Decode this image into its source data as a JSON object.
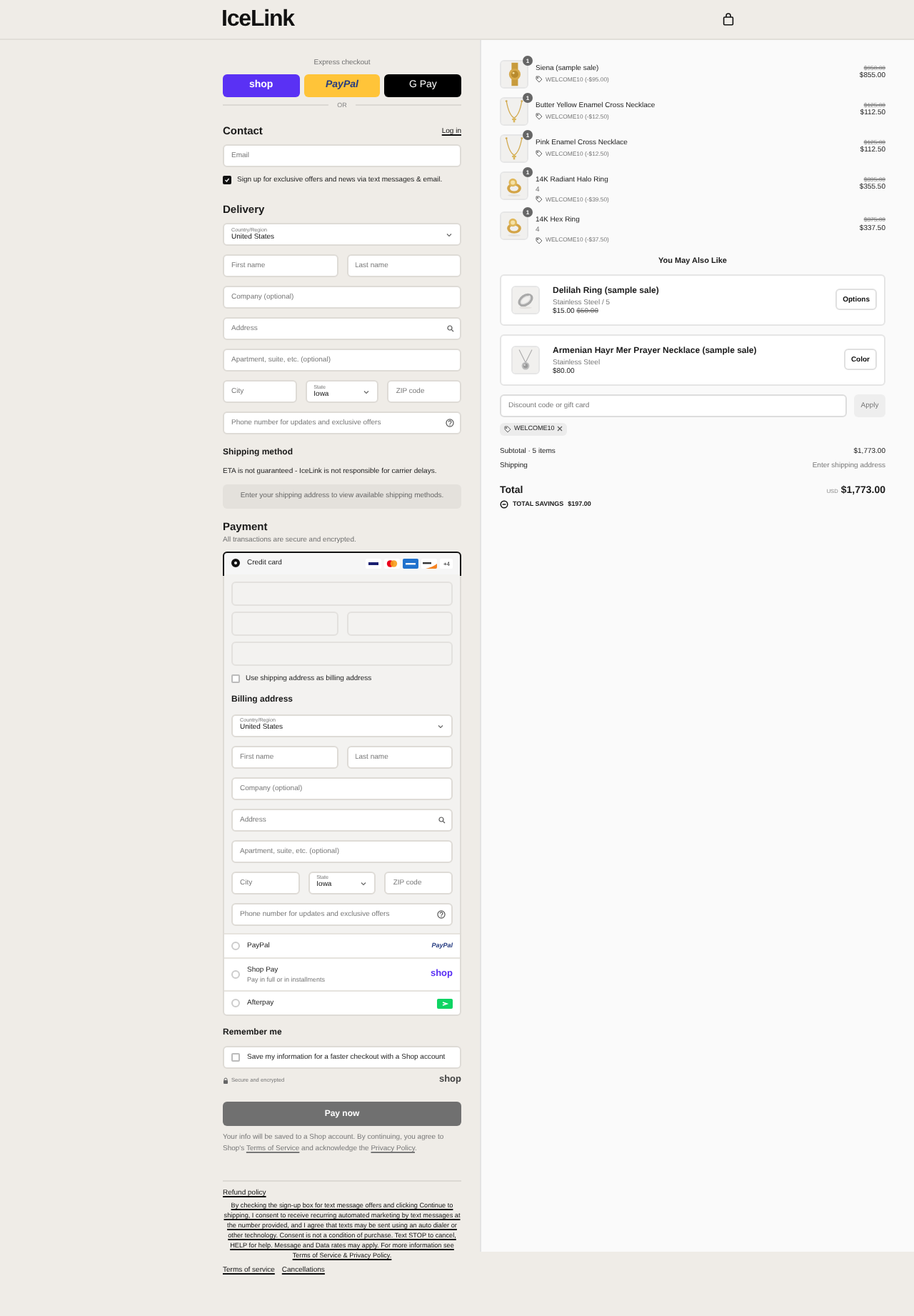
{
  "header": {
    "logo": "IceLink"
  },
  "express_checkout": {
    "title": "Express checkout",
    "buttons": [
      {
        "kind": "shop",
        "label": "shop"
      },
      {
        "kind": "paypal",
        "label": "PayPal"
      },
      {
        "kind": "gpay",
        "label": "G Pay"
      }
    ],
    "divider": "OR"
  },
  "contact": {
    "title": "Contact",
    "login_link": "Log in",
    "email": {
      "placeholder": "Email"
    },
    "marketing_opt_in": {
      "label": "Sign up for exclusive offers and news via text messages & email.",
      "checked": true
    }
  },
  "delivery": {
    "title": "Delivery",
    "country": {
      "label": "Country/Region",
      "value": "United States"
    },
    "first_name": {
      "placeholder": "First name"
    },
    "last_name": {
      "placeholder": "Last name"
    },
    "company": {
      "placeholder": "Company (optional)"
    },
    "address": {
      "placeholder": "Address"
    },
    "apartment": {
      "placeholder": "Apartment, suite, etc. (optional)"
    },
    "city": {
      "placeholder": "City"
    },
    "state": {
      "label": "State",
      "value": "Iowa"
    },
    "zip": {
      "placeholder": "ZIP code"
    },
    "phone": {
      "placeholder": "Phone number for updates and exclusive offers"
    }
  },
  "shipping_method": {
    "title": "Shipping method",
    "note": "ETA is not guaranteed - IceLink is not responsible for carrier delays.",
    "notice": "Enter your shipping address to view available shipping methods."
  },
  "payment": {
    "title": "Payment",
    "subtitle": "All transactions are secure and encrypted.",
    "methods": [
      {
        "kind": "card",
        "label": "Credit card",
        "more_brands": "+4",
        "selected": true
      },
      {
        "kind": "paypal",
        "label": "PayPal",
        "logo": "PayPal",
        "selected": false
      },
      {
        "kind": "shoppay",
        "label": "Shop Pay",
        "sublabel": "Pay in full or in installments",
        "logo": "shop",
        "selected": false
      },
      {
        "kind": "afterpay",
        "label": "Afterpay",
        "selected": false
      }
    ],
    "same_as_shipping": {
      "label": "Use shipping address as billing address",
      "checked": false
    },
    "billing_address": {
      "title": "Billing address",
      "country": {
        "label": "Country/Region",
        "value": "United States"
      },
      "first_name": {
        "placeholder": "First name"
      },
      "last_name": {
        "placeholder": "Last name"
      },
      "company": {
        "placeholder": "Company (optional)"
      },
      "address": {
        "placeholder": "Address"
      },
      "apartment": {
        "placeholder": "Apartment, suite, etc. (optional)"
      },
      "city": {
        "placeholder": "City"
      },
      "state": {
        "label": "State",
        "value": "Iowa"
      },
      "zip": {
        "placeholder": "ZIP code"
      },
      "phone": {
        "placeholder": "Phone number for updates and exclusive offers"
      }
    }
  },
  "remember_me": {
    "title": "Remember me",
    "save_info": {
      "label": "Save my information for a faster checkout with a Shop account",
      "checked": false
    },
    "secure_note": "Secure and encrypted",
    "logo": "shop"
  },
  "pay_button": "Pay now",
  "legal": [
    {
      "kind": "text",
      "text": "Your info will be saved to a Shop account. By continuing, you agree to Shop's "
    },
    {
      "kind": "link",
      "text": "Terms of Service"
    },
    {
      "kind": "text",
      "text": " and acknowledge the "
    },
    {
      "kind": "link",
      "text": "Privacy Policy"
    },
    {
      "kind": "text",
      "text": "."
    }
  ],
  "footer": {
    "refund_policy": "Refund policy",
    "sms_consent": "By checking the sign-up box for text message offers and clicking Continue to shipping, I consent to receive recurring automated marketing by text messages at the number provided, and I agree that texts may be sent using an auto dialer or other technology. Consent is not a condition of purchase. Text STOP to cancel, HELP for help. Message and Data rates may apply. For more information see Terms of Service & Privacy Policy.",
    "links": [
      "Terms of service",
      "Cancellations"
    ]
  },
  "order_summary": {
    "items": [
      {
        "name": "Siena (sample sale)",
        "quantity": "1",
        "discount": "WELCOME10 (-$95.00)",
        "original_price": "$950.00",
        "price": "$855.00"
      },
      {
        "name": "Butter Yellow Enamel Cross Necklace",
        "quantity": "1",
        "discount": "WELCOME10 (-$12.50)",
        "original_price": "$125.00",
        "price": "$112.50"
      },
      {
        "name": "Pink Enamel Cross Necklace",
        "quantity": "1",
        "discount": "WELCOME10 (-$12.50)",
        "original_price": "$125.00",
        "price": "$112.50"
      },
      {
        "name": "14K Radiant Halo Ring",
        "quantity": "1",
        "variant": "4",
        "discount": "WELCOME10 (-$39.50)",
        "original_price": "$395.00",
        "price": "$355.50"
      },
      {
        "name": "14K Hex Ring",
        "quantity": "1",
        "variant": "4",
        "discount": "WELCOME10 (-$37.50)",
        "original_price": "$375.00",
        "price": "$337.50"
      }
    ],
    "recommendations": {
      "title": "You May Also Like",
      "items": [
        {
          "name": "Delilah Ring (sample sale)",
          "variant": "Stainless Steel / 5",
          "price": "$15.00",
          "compare_price": "$50.00",
          "button": "Options"
        },
        {
          "name": "Armenian Hayr Mer Prayer Necklace (sample sale)",
          "variant": "Stainless Steel",
          "price": "$80.00",
          "button": "Color"
        }
      ]
    },
    "discount": {
      "placeholder": "Discount code or gift card",
      "button": "Apply",
      "applied": [
        "WELCOME10"
      ]
    },
    "totals": {
      "subtotal_label": "Subtotal · 5 items",
      "subtotal": "$1,773.00",
      "shipping_label": "Shipping",
      "shipping": "Enter shipping address",
      "total_label": "Total",
      "currency": "USD",
      "total": "$1,773.00",
      "savings_label": "TOTAL SAVINGS",
      "savings": "$197.00"
    }
  }
}
